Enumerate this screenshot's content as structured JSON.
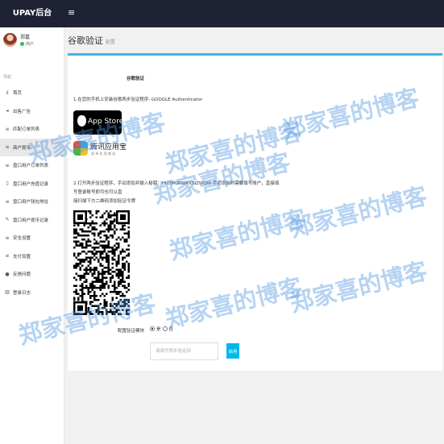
{
  "app": {
    "brand": "UPAY后台",
    "menu_toggle_glyph": "≡"
  },
  "user": {
    "name": "郑嘉",
    "role": "商户",
    "status_color": "#2dbb5a"
  },
  "sidebar": {
    "section_label": "导航",
    "items": [
      {
        "icon": "bar-chart-icon",
        "glyph": "ıl",
        "label": "首页"
      },
      {
        "icon": "bullhorn-icon",
        "glyph": "◂",
        "label": "出售广告"
      },
      {
        "icon": "list-icon",
        "glyph": "≡",
        "label": "匹配订单列表"
      },
      {
        "icon": "list-icon",
        "glyph": "≡",
        "label": "商户提币",
        "active": true
      },
      {
        "icon": "list-icon",
        "glyph": "≡",
        "label": "盘口用户订单列表"
      },
      {
        "icon": "file-icon",
        "glyph": "▯",
        "label": "盘口用户充值记录"
      },
      {
        "icon": "list-icon",
        "glyph": "≡",
        "label": "盘口用户钱包地址"
      },
      {
        "icon": "edit-icon",
        "glyph": "✎",
        "label": "盘口用户提币记录"
      },
      {
        "icon": "list-icon",
        "glyph": "≡",
        "label": "安全设置"
      },
      {
        "icon": "list-icon",
        "glyph": "≡",
        "label": "支付设置"
      },
      {
        "icon": "comment-icon",
        "glyph": "●",
        "label": "反馈问题"
      },
      {
        "icon": "book-icon",
        "glyph": "▥",
        "label": "登录日志"
      }
    ]
  },
  "page": {
    "title": "谷歌验证",
    "subtitle": "配置"
  },
  "google_auth": {
    "card_title": "谷歌验证",
    "step1": "1.在您的手机上安装谷歌两步验证程序: GOOGLE Authenticator",
    "appstore_label": "App Store",
    "tencent_name": "腾讯应用宝",
    "tencent_sub": "安 卓 应 用 商 店",
    "step2_line1": "2.打开两步验证程序，手动添加并输入秘钥：HU2MUPGIRXSIZWQW 手动添加时需要填写账户，直接填写登录账号即可也可以直",
    "step2_line2": "接扫描下方二维码添加验证令牌",
    "config_label": "配置验证模块",
    "option_yes": "是",
    "option_no": "否",
    "selected": "是",
    "input_placeholder": "请填写两步验证码",
    "enable_button": "启用"
  },
  "watermark": {
    "text": "郑家喜的博客"
  },
  "colors": {
    "topbar": "#1e2234",
    "accent": "#3cb8e6",
    "button": "#00b7ee"
  }
}
